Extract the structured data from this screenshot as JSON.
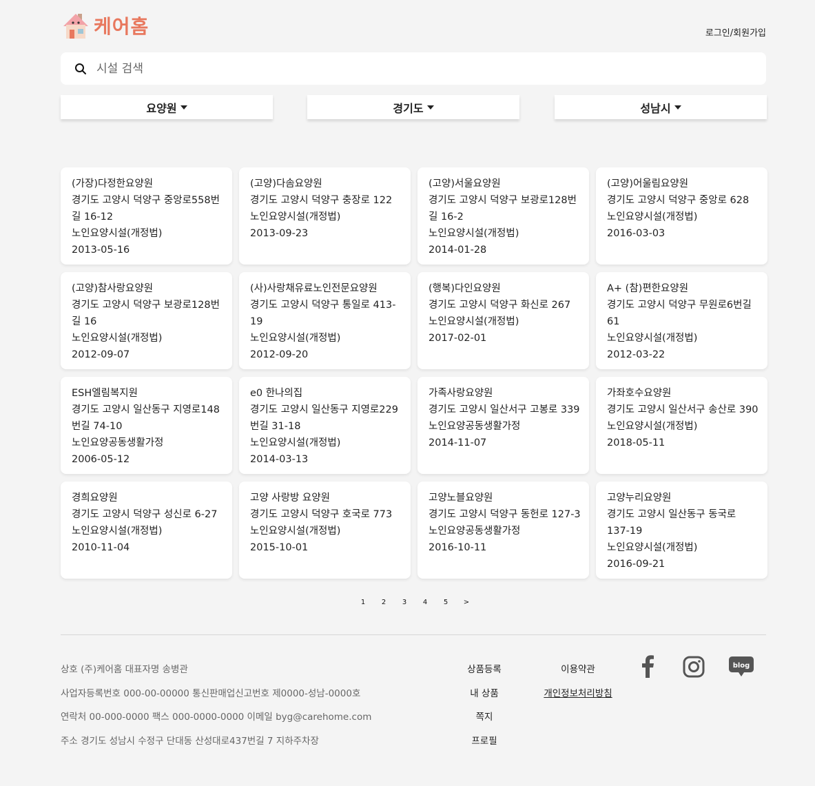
{
  "header": {
    "logo_text": "케어홈",
    "login_label": "로그인/회원가입"
  },
  "search": {
    "placeholder": "시설 검색"
  },
  "filters": {
    "type": "요양원",
    "province": "경기도",
    "city": "성남시"
  },
  "facilities": [
    {
      "name": "(가장)다정한요양원",
      "address": "경기도 고양시 덕양구 중앙로558번길 16-12",
      "category": "노인요양시설(개정법)",
      "date": "2013-05-16"
    },
    {
      "name": "(고양)다솜요양원",
      "address": "경기도 고양시 덕양구 충장로 122",
      "category": "노인요양시설(개정법)",
      "date": "2013-09-23"
    },
    {
      "name": "(고양)서울요양원",
      "address": "경기도 고양시 덕양구 보광로128번길 16-2",
      "category": "노인요양시설(개정법)",
      "date": "2014-01-28"
    },
    {
      "name": "(고양)어울림요양원",
      "address": "경기도 고양시 덕양구 중앙로 628",
      "category": "노인요양시설(개정법)",
      "date": "2016-03-03"
    },
    {
      "name": "(고양)참사랑요양원",
      "address": "경기도 고양시 덕양구 보광로128번길 16",
      "category": "노인요양시설(개정법)",
      "date": "2012-09-07"
    },
    {
      "name": "(사)사랑채유료노인전문요양원",
      "address": "경기도 고양시 덕양구 통일로 413-19",
      "category": "노인요양시설(개정법)",
      "date": "2012-09-20"
    },
    {
      "name": "(행복)다인요양원",
      "address": "경기도 고양시 덕양구 화신로 267",
      "category": "노인요양시설(개정법)",
      "date": "2017-02-01"
    },
    {
      "name": "A+ (참)편한요양원",
      "address": "경기도 고양시 덕양구 무원로6번길 61",
      "category": "노인요양시설(개정법)",
      "date": "2012-03-22"
    },
    {
      "name": "ESH엘림복지원",
      "address": "경기도 고양시 일산동구 지영로148번길 74-10",
      "category": "노인요양공동생활가정",
      "date": "2006-05-12"
    },
    {
      "name": "e0 한나의집",
      "address": "경기도 고양시 일산동구 지영로229번길 31-18",
      "category": "노인요양시설(개정법)",
      "date": "2014-03-13"
    },
    {
      "name": "가족사랑요양원",
      "address": "경기도 고양시 일산서구 고봉로 339",
      "category": "노인요양공동생활가정",
      "date": "2014-11-07"
    },
    {
      "name": "가좌호수요양원",
      "address": "경기도 고양시 일산서구 송산로 390",
      "category": "노인요양시설(개정법)",
      "date": "2018-05-11"
    },
    {
      "name": "경희요양원",
      "address": "경기도 고양시 덕양구 성신로 6-27",
      "category": "노인요양시설(개정법)",
      "date": "2010-11-04"
    },
    {
      "name": "고양 사랑방 요양원",
      "address": "경기도 고양시 덕양구 호국로 773",
      "category": "노인요양시설(개정법)",
      "date": "2015-10-01"
    },
    {
      "name": "고양노블요양원",
      "address": "경기도 고양시 덕양구 동헌로 127-3",
      "category": "노인요양공동생활가정",
      "date": "2016-10-11"
    },
    {
      "name": "고양누리요양원",
      "address": "경기도 고양시 일산동구 동국로 137-19",
      "category": "노인요양시설(개정법)",
      "date": "2016-09-21"
    }
  ],
  "pagination": [
    "1",
    "2",
    "3",
    "4",
    "5",
    ">"
  ],
  "footer": {
    "company": "상호 (주)케어홈 대표자명 송병관",
    "registration": "사업자등록번호 000-00-00000 통신판매업신고번호 제0000-성남-0000호",
    "contact": "연락처 00-000-0000 팩스 000-0000-0000 이메일 byg@carehome.com",
    "address": "주소 경기도 성남시 수정구 단대동 산성대로437번길 7 지하주차장",
    "links_col1": [
      "상품등록",
      "내 상품",
      "쪽지",
      "프로필"
    ],
    "links_col2": [
      "이용약관",
      "개인정보처리방침"
    ],
    "social": [
      "facebook-icon",
      "instagram-icon",
      "blog-icon"
    ],
    "blog_label": "blog"
  },
  "colors": {
    "brand": "#e8785e",
    "background": "#f4f4f4"
  }
}
